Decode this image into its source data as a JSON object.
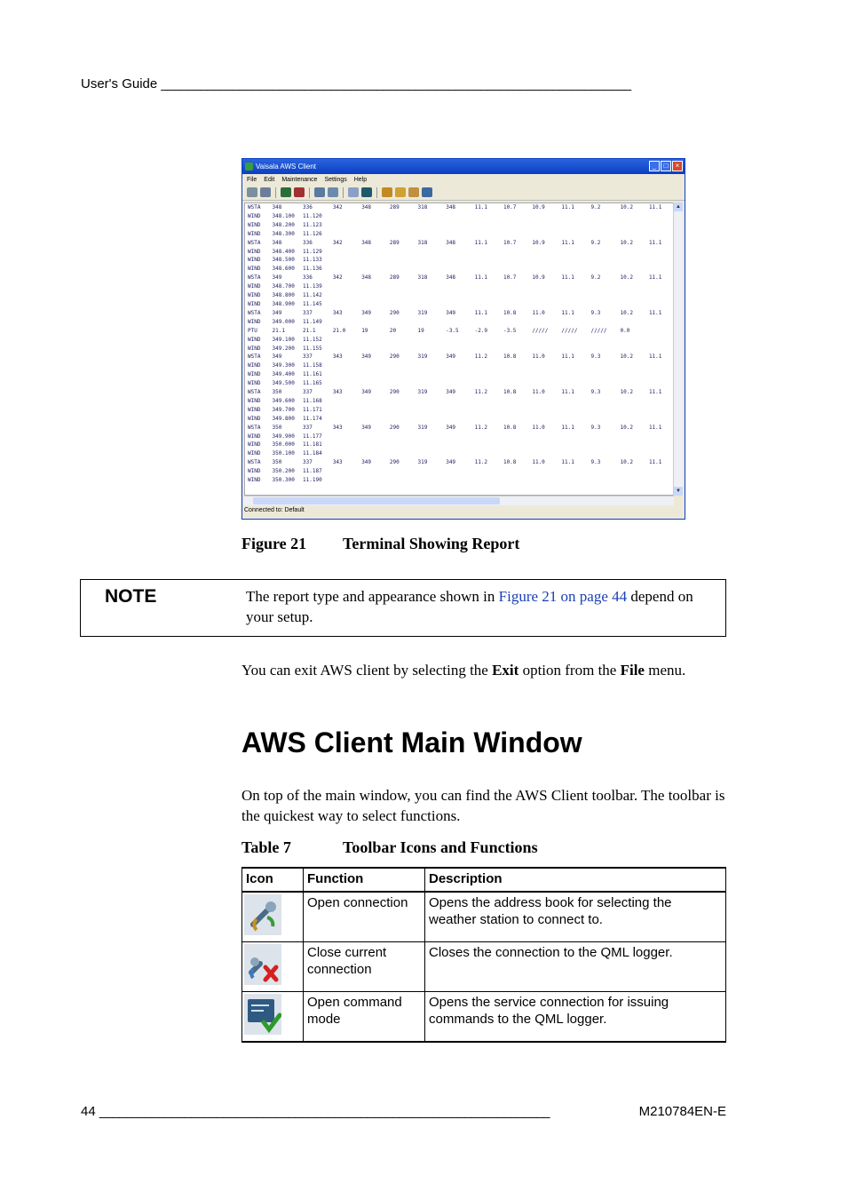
{
  "header": {
    "left": "User's Guide",
    "rule": "________________________________________________________________________"
  },
  "footer": {
    "page": "44",
    "rule": "_____________________________________________________________________",
    "doc_code": "M210784EN-E"
  },
  "window": {
    "title": "Vaisala AWS Client",
    "menu": [
      "File",
      "Edit",
      "Maintenance",
      "Settings",
      "Help"
    ],
    "status": "Connected to: Default",
    "terminal_rows": [
      [
        "WSTA",
        "348",
        "336",
        "342",
        "348",
        "289",
        "318",
        "348",
        "11.1",
        "10.7",
        "10.9",
        "11.1",
        "9.2",
        "10.2",
        "11.1"
      ],
      [
        "WIND",
        "348.100",
        "11.120"
      ],
      [
        "WIND",
        "348.200",
        "11.123"
      ],
      [
        "WIND",
        "348.300",
        "11.126"
      ],
      [
        "WSTA",
        "348",
        "336",
        "342",
        "348",
        "289",
        "318",
        "348",
        "11.1",
        "10.7",
        "10.9",
        "11.1",
        "9.2",
        "10.2",
        "11.1"
      ],
      [
        "WIND",
        "348.400",
        "11.129"
      ],
      [
        "WIND",
        "348.500",
        "11.133"
      ],
      [
        "WIND",
        "348.600",
        "11.136"
      ],
      [
        "WSTA",
        "349",
        "336",
        "342",
        "348",
        "289",
        "318",
        "348",
        "11.1",
        "10.7",
        "10.9",
        "11.1",
        "9.2",
        "10.2",
        "11.1"
      ],
      [
        "WIND",
        "348.700",
        "11.139"
      ],
      [
        "WIND",
        "348.800",
        "11.142"
      ],
      [
        "WIND",
        "348.900",
        "11.145"
      ],
      [
        "WSTA",
        "349",
        "337",
        "343",
        "349",
        "290",
        "319",
        "349",
        "11.1",
        "10.8",
        "11.0",
        "11.1",
        "9.3",
        "10.2",
        "11.1"
      ],
      [
        "WIND",
        "349.000",
        "11.149"
      ],
      [
        "PTU",
        "21.1",
        "21.1",
        "21.0",
        "19",
        "20",
        "19",
        "-3.5",
        "-2.9",
        "-3.5",
        "/////",
        "/////",
        "/////",
        "0.0"
      ],
      [
        "WIND",
        "349.100",
        "11.152"
      ],
      [
        "WIND",
        "349.200",
        "11.155"
      ],
      [
        "WSTA",
        "349",
        "337",
        "343",
        "349",
        "290",
        "319",
        "349",
        "11.2",
        "10.8",
        "11.0",
        "11.1",
        "9.3",
        "10.2",
        "11.1"
      ],
      [
        "WIND",
        "349.300",
        "11.158"
      ],
      [
        "WIND",
        "349.400",
        "11.161"
      ],
      [
        "WIND",
        "349.500",
        "11.165"
      ],
      [
        "WSTA",
        "350",
        "337",
        "343",
        "349",
        "290",
        "319",
        "349",
        "11.2",
        "10.8",
        "11.0",
        "11.1",
        "9.3",
        "10.2",
        "11.1"
      ],
      [
        "WIND",
        "349.600",
        "11.168"
      ],
      [
        "WIND",
        "349.700",
        "11.171"
      ],
      [
        "WIND",
        "349.800",
        "11.174"
      ],
      [
        "WSTA",
        "350",
        "337",
        "343",
        "349",
        "290",
        "319",
        "349",
        "11.2",
        "10.8",
        "11.0",
        "11.1",
        "9.3",
        "10.2",
        "11.1"
      ],
      [
        "WIND",
        "349.900",
        "11.177"
      ],
      [
        "WIND",
        "350.000",
        "11.181"
      ],
      [
        "WIND",
        "350.100",
        "11.184"
      ],
      [
        "WSTA",
        "350",
        "337",
        "343",
        "349",
        "290",
        "319",
        "349",
        "11.2",
        "10.8",
        "11.0",
        "11.1",
        "9.3",
        "10.2",
        "11.1"
      ],
      [
        "WIND",
        "350.200",
        "11.187"
      ],
      [
        "WIND",
        "350.300",
        "11.190"
      ]
    ]
  },
  "figure_caption": {
    "number": "Figure 21",
    "title": "Terminal Showing Report"
  },
  "note": {
    "label": "NOTE",
    "text_before": "The report type and appearance shown in ",
    "link": "Figure 21 on page 44",
    "text_after": " depend on your setup."
  },
  "exit_para": {
    "t1": "You can exit AWS client by selecting the ",
    "b1": "Exit",
    "t2": " option from the ",
    "b2": "File",
    "t3": " menu."
  },
  "section_heading": "AWS Client Main Window",
  "intro_para": "On top of the main window, you can find the AWS Client toolbar. The toolbar is the quickest way to select functions.",
  "table_caption": {
    "number": "Table 7",
    "title": "Toolbar Icons and Functions"
  },
  "table": {
    "headers": [
      "Icon",
      "Function",
      "Description"
    ],
    "rows": [
      {
        "icon": "open-connection-icon",
        "function": "Open connection",
        "description": "Opens the address book for selecting the weather station to connect to."
      },
      {
        "icon": "close-connection-icon",
        "function": "Close current connection",
        "description": "Closes the connection to the QML logger."
      },
      {
        "icon": "command-mode-icon",
        "function": "Open command mode",
        "description": "Opens the service connection for issuing commands to the QML logger."
      }
    ]
  },
  "colors": {
    "link": "#1a3fb5",
    "titlebar": "#0a3fc2",
    "terminal_text": "#1a1a60"
  }
}
